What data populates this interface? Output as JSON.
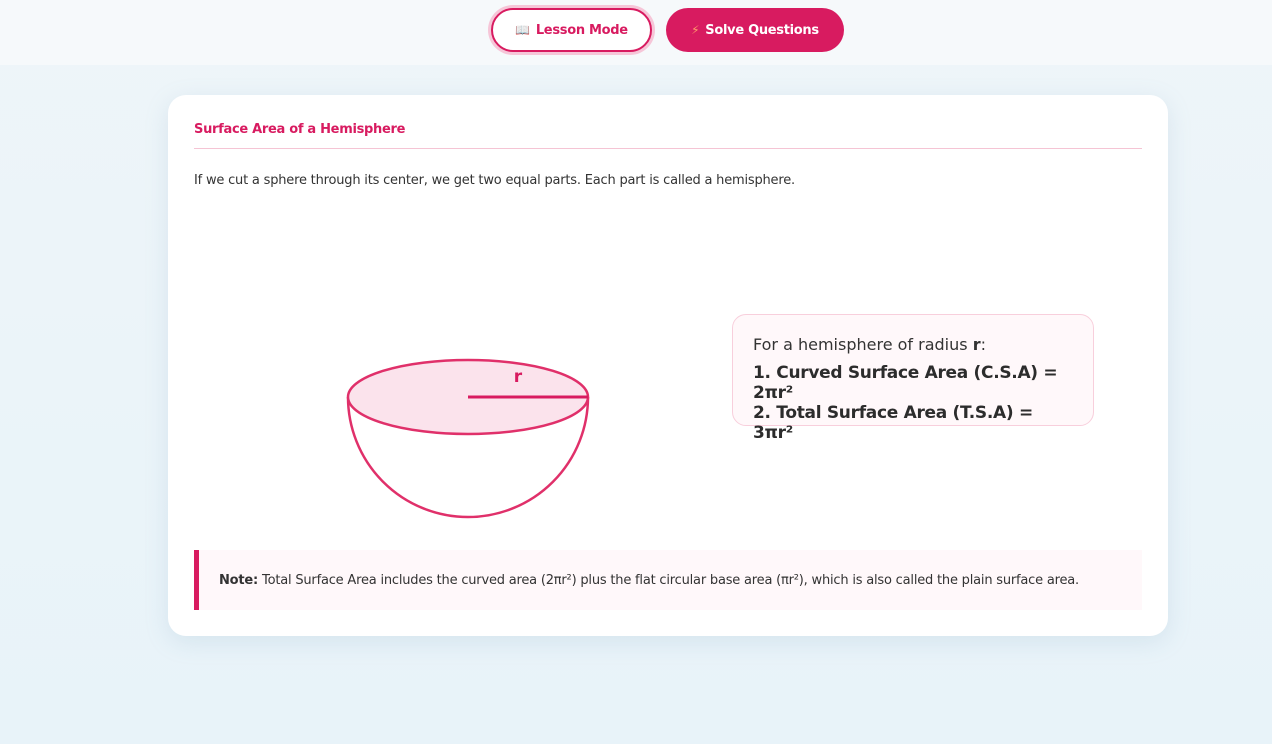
{
  "header": {
    "lesson_mode_label": "Lesson Mode",
    "lesson_mode_icon": "open-book-icon",
    "solve_questions_label": "Solve Questions",
    "solve_questions_icon": "lightning-icon"
  },
  "lesson": {
    "title": "Surface Area of a Hemisphere",
    "intro": "If we cut a sphere through its center, we get two equal parts. Each part is called a hemisphere.",
    "figure": {
      "radius_label": "r"
    },
    "formula": {
      "lead_text": "For a hemisphere of radius ",
      "lead_var": "r",
      "lead_suffix": ":",
      "lines": [
        "1. Curved Surface Area (C.S.A) = 2πr²",
        "2. Total Surface Area (T.S.A) = 3πr²"
      ]
    },
    "note": {
      "label": "Note:",
      "text": "Total Surface Area includes the curved area (2πr²) plus the flat circular base area (πr²), which is also called the plain surface area."
    }
  },
  "colors": {
    "accent": "#d81b60",
    "accent_light": "#f8e2ea",
    "background": "#e8f3f9"
  }
}
